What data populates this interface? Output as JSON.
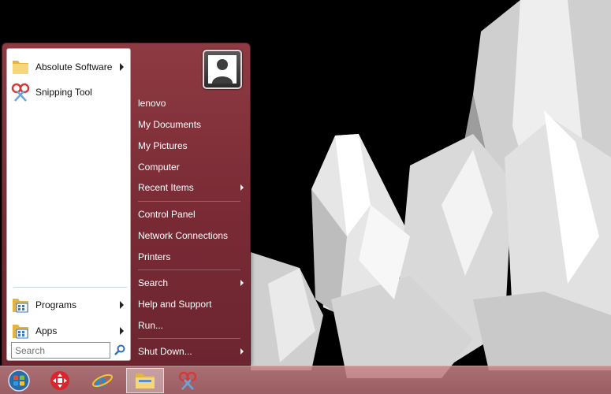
{
  "start_menu": {
    "pinned": [
      {
        "label": "Absolute Software",
        "icon": "folder-icon",
        "has_submenu": true
      },
      {
        "label": "Snipping Tool",
        "icon": "snipping-tool-icon",
        "has_submenu": false
      }
    ],
    "bottom": [
      {
        "label": "Programs",
        "icon": "programs-icon",
        "has_submenu": true
      },
      {
        "label": "Apps",
        "icon": "apps-icon",
        "has_submenu": true
      }
    ],
    "search": {
      "placeholder": "Search"
    },
    "right_items": [
      {
        "label": "lenovo",
        "has_submenu": false
      },
      {
        "label": "My Documents",
        "has_submenu": false
      },
      {
        "label": "My Pictures",
        "has_submenu": false
      },
      {
        "label": "Computer",
        "has_submenu": false
      },
      {
        "label": "Recent Items",
        "has_submenu": true
      },
      {
        "label": "Control Panel",
        "has_submenu": false
      },
      {
        "label": "Network Connections",
        "has_submenu": false
      },
      {
        "label": "Printers",
        "has_submenu": false
      },
      {
        "label": "Search",
        "has_submenu": true
      },
      {
        "label": "Help and Support",
        "has_submenu": false
      },
      {
        "label": "Run...",
        "has_submenu": false
      },
      {
        "label": "Shut Down...",
        "has_submenu": true
      }
    ]
  },
  "taskbar": {
    "items": [
      {
        "icon": "start-orb-icon",
        "active": false
      },
      {
        "icon": "remote-app-icon",
        "active": false
      },
      {
        "icon": "internet-explorer-icon",
        "active": false
      },
      {
        "icon": "file-explorer-icon",
        "active": true
      },
      {
        "icon": "snipping-tool-icon",
        "active": false
      }
    ]
  },
  "colors": {
    "menu_bg": "#7a2b35",
    "taskbar": "#c2868b"
  }
}
